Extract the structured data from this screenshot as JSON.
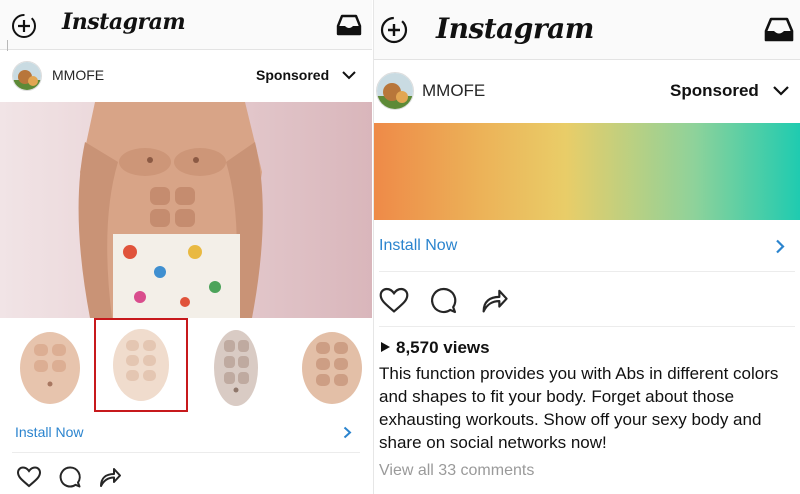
{
  "app": {
    "brand": "Instagram"
  },
  "post": {
    "username": "MMOFE",
    "sponsored_label": "Sponsored",
    "install_label": "Install Now",
    "views": "8,570 views",
    "caption": "This function provides you with Abs in different colors and shapes to fit your body. Forget about those exhausting workouts. Show off your sexy body and  share on social networks now!",
    "comments_link": "View all 33 comments"
  },
  "thumbnails": {
    "count": 4,
    "selected_index": 1
  },
  "colors": {
    "install_blue": "#2b84ce",
    "selection_red": "#c7191c",
    "gradient": [
      "#ee8a48",
      "#ecb258",
      "#e9cd68",
      "#8fd29a",
      "#1fcbb0"
    ]
  },
  "icons": {
    "top_left": "add-story-icon",
    "top_right": "inbox-icon",
    "header_right": "chevron-down-icon",
    "install_arrow": "chevron-right-icon",
    "actions": [
      "heart-icon",
      "comment-icon",
      "share-icon"
    ]
  }
}
